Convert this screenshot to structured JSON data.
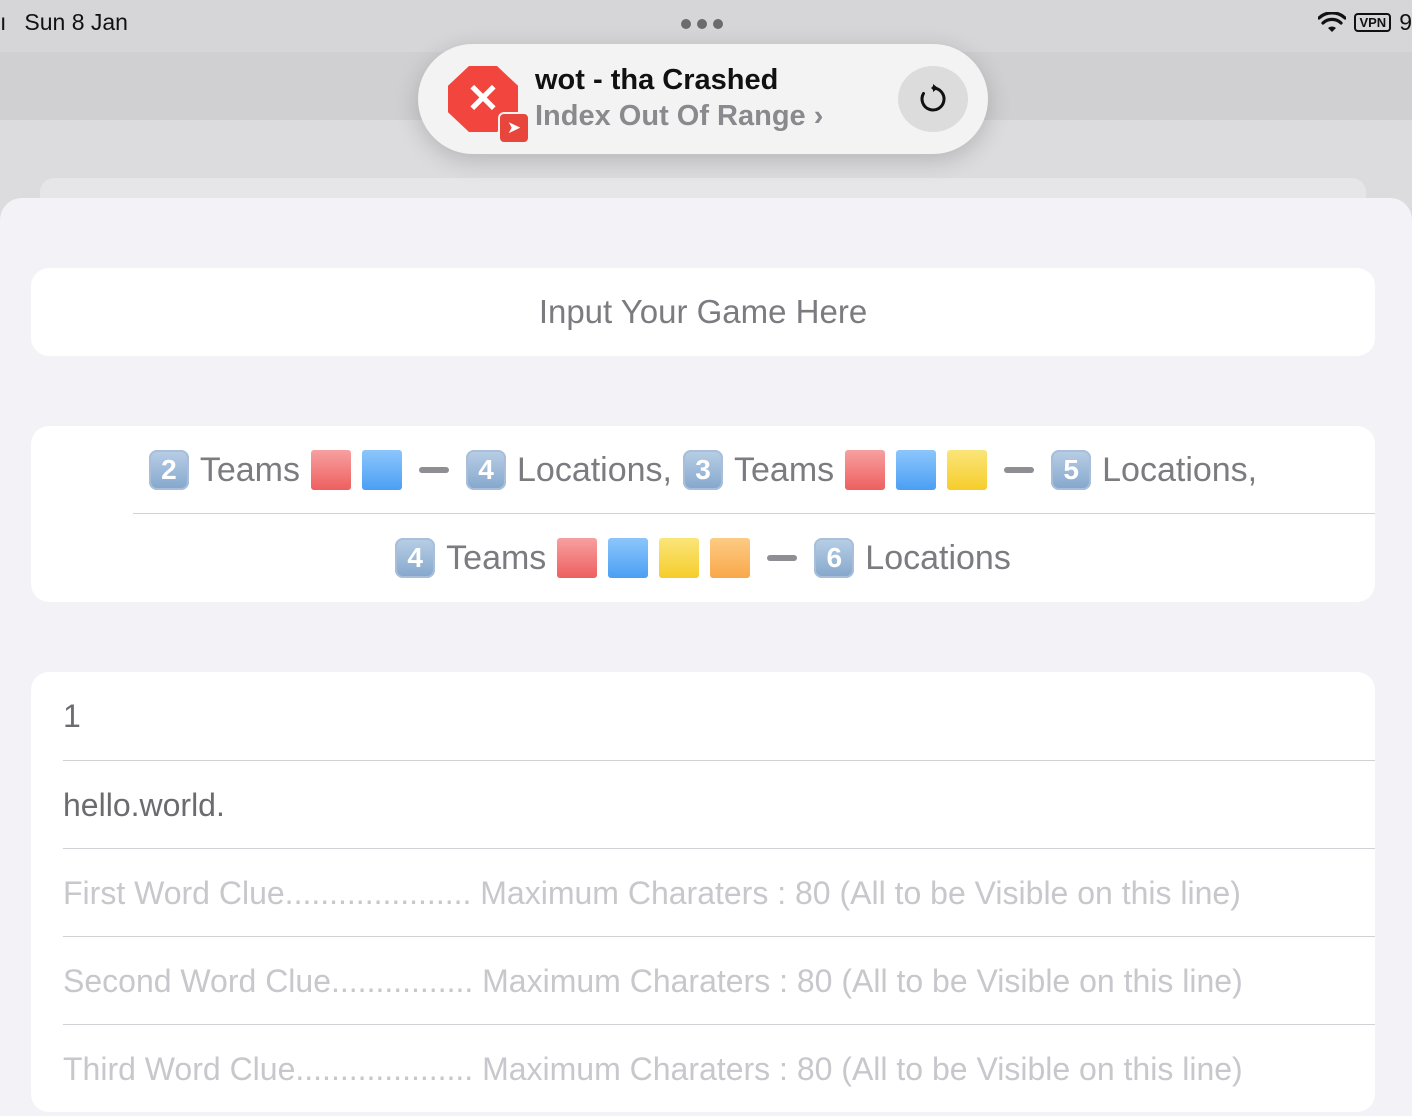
{
  "status_bar": {
    "edge_text": "ı",
    "date": "Sun 8 Jan",
    "vpn_label": "VPN",
    "battery_partial": "9"
  },
  "banner": {
    "title": "wot - tha Crashed",
    "subtitle": "Index Out Of Range",
    "chevron": "›",
    "app_icon": "crash-octagon-icon",
    "reload_icon": "reload-icon",
    "colors": {
      "icon_red": "#f2453d"
    }
  },
  "game_input": {
    "placeholder": "Input Your Game Here"
  },
  "options": {
    "row1": {
      "a_num": "2",
      "a_teams": "Teams",
      "a_num2": "4",
      "a_locations": "Locations,",
      "b_num": "3",
      "b_teams": "Teams",
      "b_num2": "5",
      "b_locations": "Locations,"
    },
    "row2": {
      "c_num": "4",
      "c_teams": "Teams",
      "c_num2": "6",
      "c_locations": "Locations"
    },
    "colors": {
      "red": "#f26b6b",
      "blue": "#5aa9f5",
      "yellow": "#f7d33b",
      "orange": "#fbb75c"
    }
  },
  "form": {
    "field1": "1",
    "field2": "hello.world.",
    "field3_placeholder": "First Word Clue..................... Maximum Charaters : 80 (All to be Visible on this line)",
    "field4_placeholder": "Second Word Clue................ Maximum Charaters : 80 (All to be Visible on this line)",
    "field5_placeholder": "Third Word Clue.................... Maximum Charaters : 80 (All to be Visible on this line)"
  }
}
